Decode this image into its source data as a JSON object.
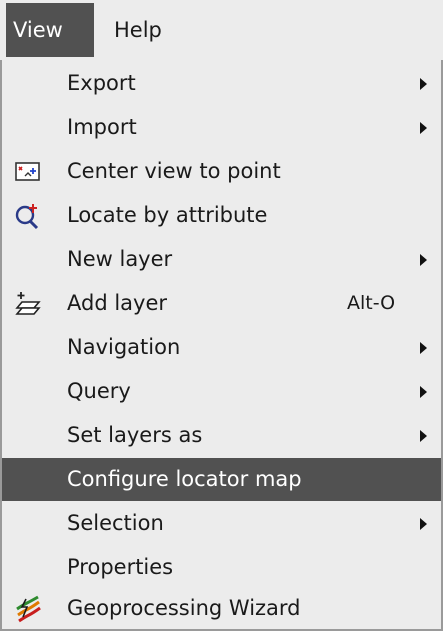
{
  "menubar": {
    "items": [
      {
        "label": "View"
      },
      {
        "label": "Help"
      }
    ]
  },
  "menu": {
    "items": [
      {
        "label": "Export",
        "submenu": true
      },
      {
        "label": "Import",
        "submenu": true
      },
      {
        "label": "Center view to point",
        "icon": "center-view-icon"
      },
      {
        "label": "Locate by attribute",
        "icon": "locate-attribute-icon"
      },
      {
        "label": "New layer",
        "submenu": true
      },
      {
        "label": "Add layer",
        "icon": "add-layer-icon",
        "shortcut": "Alt-O"
      },
      {
        "label": "Navigation",
        "submenu": true
      },
      {
        "label": "Query",
        "submenu": true
      },
      {
        "label": "Set layers as",
        "submenu": true
      },
      {
        "label": "Configure locator map",
        "highlighted": true
      },
      {
        "label": "Selection",
        "submenu": true
      },
      {
        "label": "Properties"
      },
      {
        "label": "Geoprocessing Wizard",
        "icon": "geoprocessing-wizard-icon"
      }
    ]
  },
  "colors": {
    "menu_background": "#ececec",
    "highlight": "#515151",
    "highlight_text": "#ffffff"
  }
}
